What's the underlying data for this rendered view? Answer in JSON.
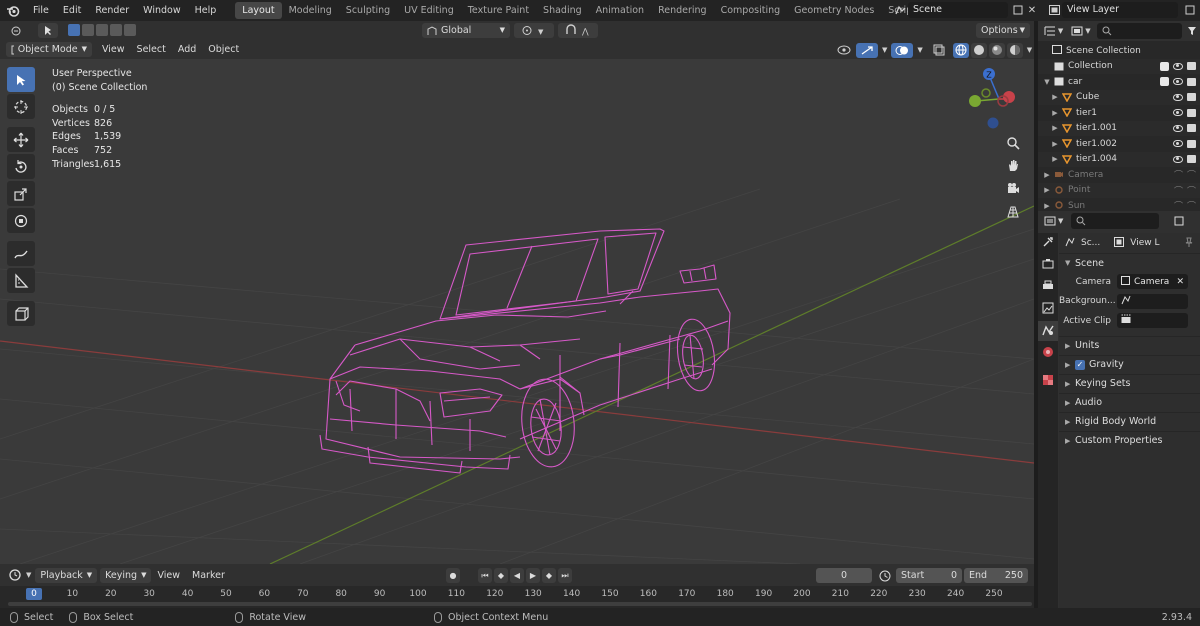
{
  "app": {
    "menus": [
      "File",
      "Edit",
      "Render",
      "Window",
      "Help"
    ],
    "workspaces": [
      "Layout",
      "Modeling",
      "Sculpting",
      "UV Editing",
      "Texture Paint",
      "Shading",
      "Animation",
      "Rendering",
      "Compositing",
      "Geometry Nodes",
      "Scripting"
    ],
    "active_workspace": "Layout",
    "add_workspace": "+",
    "scene": "Scene",
    "view_layer": "View Layer"
  },
  "viewport_header": {
    "mode": "Object Mode",
    "menus": [
      "View",
      "Select",
      "Add",
      "Object"
    ],
    "transform_orientation": "Global",
    "options": "Options"
  },
  "viewport": {
    "perspective": "User Perspective",
    "collection": "(0) Scene Collection",
    "stats": [
      {
        "label": "Objects",
        "value": "0 / 5"
      },
      {
        "label": "Vertices",
        "value": "826"
      },
      {
        "label": "Edges",
        "value": "1,539"
      },
      {
        "label": "Faces",
        "value": "752"
      },
      {
        "label": "Triangles",
        "value": "1,615"
      }
    ],
    "wire_color": "#d659c8",
    "gizmo_z": "Z"
  },
  "outliner": {
    "root": "Scene Collection",
    "rows": [
      {
        "name": "Collection",
        "indent": 1,
        "kind": "collection"
      },
      {
        "name": "car",
        "indent": 1,
        "kind": "collection"
      },
      {
        "name": "Cube",
        "indent": 2,
        "kind": "mesh"
      },
      {
        "name": "tier1",
        "indent": 2,
        "kind": "mesh"
      },
      {
        "name": "tier1.001",
        "indent": 2,
        "kind": "mesh"
      },
      {
        "name": "tier1.002",
        "indent": 2,
        "kind": "mesh"
      },
      {
        "name": "tier1.004",
        "indent": 2,
        "kind": "mesh"
      },
      {
        "name": "Camera",
        "indent": 1,
        "kind": "camera"
      },
      {
        "name": "Point",
        "indent": 1,
        "kind": "light"
      },
      {
        "name": "Sun",
        "indent": 1,
        "kind": "light"
      }
    ]
  },
  "properties": {
    "breadcrumb_scene": "Sc...",
    "breadcrumb_layer": "View L",
    "panel_scene": "Scene",
    "camera_label": "Camera",
    "camera_value": "Camera",
    "background_label": "Backgroun...",
    "active_clip_label": "Active Clip",
    "panels": [
      "Units",
      "Gravity",
      "Keying Sets",
      "Audio",
      "Rigid Body World",
      "Custom Properties"
    ]
  },
  "timeline": {
    "menus": [
      "Playback",
      "Keying",
      "View",
      "Marker"
    ],
    "current_frame": "0",
    "start_label": "Start",
    "start": "0",
    "end_label": "End",
    "end": "250",
    "ticks": [
      "0",
      "10",
      "20",
      "30",
      "40",
      "50",
      "60",
      "70",
      "80",
      "90",
      "100",
      "110",
      "120",
      "130",
      "140",
      "150",
      "160",
      "170",
      "180",
      "190",
      "200",
      "210",
      "220",
      "230",
      "240",
      "250"
    ]
  },
  "statusbar": {
    "select": "Select",
    "box_select": "Box Select",
    "rotate_view": "Rotate View",
    "context_menu": "Object Context Menu",
    "version": "2.93.4"
  }
}
